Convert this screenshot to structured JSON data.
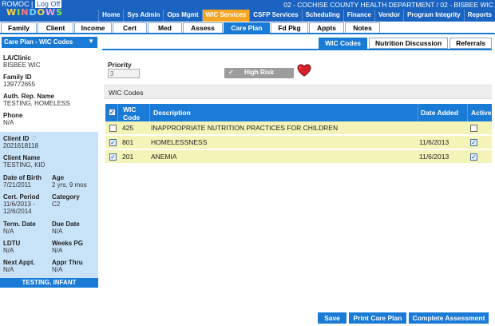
{
  "header": {
    "org": "ROMOC",
    "logout": "Log Off",
    "logo_text": "WINDOWS",
    "dept": "02 - COCHISE COUNTY HEALTH DEPARTMENT / 02 - BISBEE WIC",
    "nav": [
      "Home",
      "Sys Admin",
      "Ops Mgmt",
      "WIC Services",
      "CSFP Services",
      "Scheduling",
      "Finance",
      "Vendor",
      "Program Integrity",
      "Reports"
    ],
    "nav_active": "WIC Services"
  },
  "tabs": [
    "Family",
    "Client",
    "Income",
    "Cert",
    "Med",
    "Assess",
    "Care Plan",
    "Fd Pkg",
    "Appts",
    "Notes"
  ],
  "tab_active": "Care Plan",
  "sidebar": {
    "header": "Care Plan - WIC Codes",
    "la_clinic_label": "LA/Clinic",
    "la_clinic": "BISBEE WIC",
    "family_id_label": "Family ID",
    "family_id": "139772655",
    "auth_rep_label": "Auth. Rep. Name",
    "auth_rep": "TESTING, HOMELESS",
    "phone_label": "Phone",
    "phone": "N/A",
    "client_id_label": "Client ID",
    "client_id": "2021618118",
    "client_name_label": "Client Name",
    "client_name": "TESTING, KID",
    "dob_label": "Date of Birth",
    "dob": "7/21/2011",
    "age_label": "Age",
    "age": "2 yrs, 9 mos",
    "cert_label": "Cert. Period",
    "cert": "11/6/2013 - 12/6/2014",
    "category_label": "Category",
    "category": "C2",
    "term_label": "Term. Date",
    "term": "N/A",
    "due_label": "Due Date",
    "due": "N/A",
    "ldtu_label": "LDTU",
    "ldtu": "N/A",
    "weeks_label": "Weeks PG",
    "weeks": "N/A",
    "next_label": "Next Appt.",
    "next": "N/A",
    "appr_label": "Appr Thru",
    "appr": "N/A",
    "bottom": "TESTING, INFANT"
  },
  "subtabs": [
    "WIC Codes",
    "Nutrition Discussion",
    "Referrals"
  ],
  "subtab_active": "WIC Codes",
  "priority": {
    "label": "Priority",
    "placeholder": "3",
    "high_risk": "High Risk"
  },
  "codes": {
    "title": "WIC Codes",
    "columns": {
      "code": "WIC Code",
      "description": "Description",
      "date_added": "Date Added",
      "active": "Active"
    },
    "rows": [
      {
        "checked": false,
        "code": "425",
        "description": "INAPPROPRIATE NUTRITION PRACTICES FOR CHILDREN",
        "date_added": "",
        "active": false
      },
      {
        "checked": true,
        "code": "801",
        "description": "HOMELESSNESS",
        "date_added": "11/6/2013",
        "active": true
      },
      {
        "checked": true,
        "code": "201",
        "description": "ANEMIA",
        "date_added": "11/6/2013",
        "active": true
      }
    ]
  },
  "buttons": {
    "save": "Save",
    "print": "Print Care Plan",
    "complete": "Complete Assessment"
  }
}
